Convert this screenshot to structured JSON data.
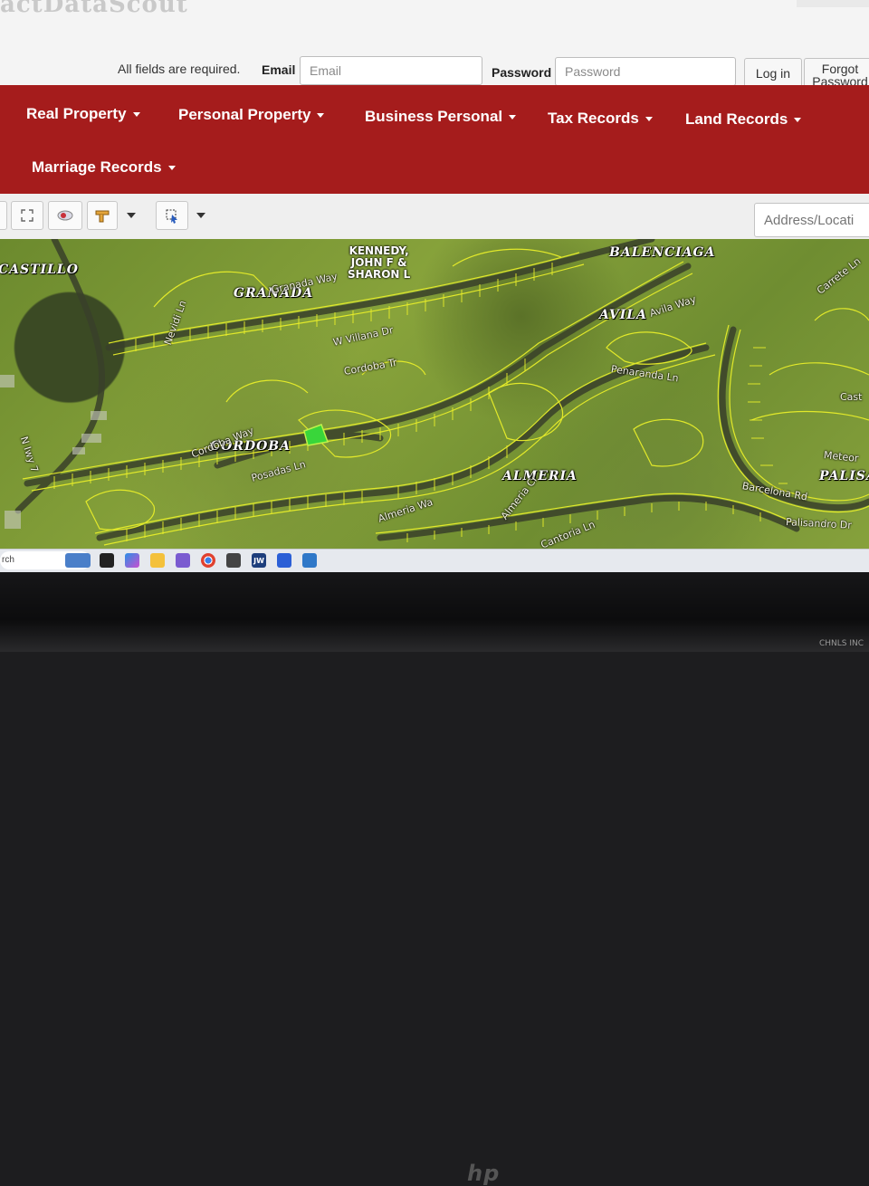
{
  "login": {
    "required_text": "All fields are required.",
    "email_label": "Email",
    "email_placeholder": "Email",
    "password_label": "Password",
    "password_placeholder": "Password",
    "login_button": "Log in",
    "forgot_line1": "Forgot",
    "forgot_line2": "Password"
  },
  "nav": {
    "items": [
      {
        "label": "Real Property"
      },
      {
        "label": "Personal Property"
      },
      {
        "label": "Business Personal"
      },
      {
        "label": "Tax Records"
      },
      {
        "label": "Land Records"
      },
      {
        "label": "Marriage Records"
      }
    ]
  },
  "toolbar": {
    "icons": [
      "fullscreen-icon",
      "layers-icon",
      "measure-ruler-icon",
      "chevron-down-icon",
      "select-tool-icon",
      "chevron-down-icon"
    ],
    "address_placeholder": "Address/Locati"
  },
  "map": {
    "subdivisions": [
      "CASTILLO",
      "GRANADA",
      "BALENCIAGA",
      "AVILA",
      "CORDOBA",
      "ALMERIA",
      "PALISA"
    ],
    "streets": [
      "Nevidi Ln",
      "Granada Way",
      "W Villana Dr",
      "Cordoba Tr",
      "Avila Way",
      "Penaranda Ln",
      "Cordoba Way",
      "Posadas Ln",
      "Almeria Wa",
      "Almeria Cr",
      "Cantoria Ln",
      "Barcelona Rd",
      "Palisandro Dr",
      "Carrete Ln",
      "Meteor",
      "Cast",
      "N Iwy 7"
    ],
    "owner_label": [
      "KENNEDY,",
      "JOHN F &",
      "SHARON L"
    ],
    "highlight_color": "#39d63a",
    "parcel_line_color": "#e8ee2a"
  },
  "taskbar": {
    "search_text": "rch",
    "apps": [
      "mail-icon",
      "store-icon",
      "copilot-icon",
      "file-explorer-icon",
      "snip-icon",
      "chrome-icon",
      "teams-icon",
      "jw-icon",
      "malwarebytes-icon",
      "calculator-icon"
    ],
    "jw_label": "JW"
  },
  "device": {
    "brand": "hp"
  },
  "watermark": "CHNLS INC"
}
